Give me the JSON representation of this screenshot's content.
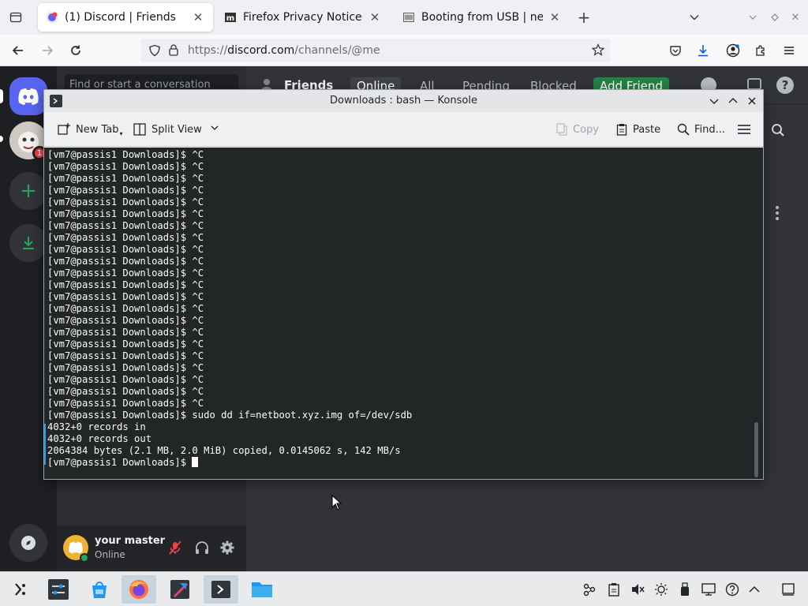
{
  "browser": {
    "tabs": [
      {
        "title": "(1) Discord | Friends",
        "active": true,
        "icon": "discord-favicon"
      },
      {
        "title": "Firefox Privacy Notice — M",
        "active": false,
        "icon": "mdn-favicon"
      },
      {
        "title": "Booting from USB | netbo",
        "active": false,
        "icon": "page-favicon"
      }
    ],
    "url_prefix": "https://",
    "url_domain": "discord.com",
    "url_path": "/channels/@me"
  },
  "discord": {
    "search_placeholder": "Find or start a conversation",
    "friends_label": "Friends",
    "friend_tabs": [
      "Online",
      "All",
      "Pending",
      "Blocked"
    ],
    "add_friend_label": "Add Friend",
    "notification_count": "1",
    "user": {
      "name": "your master",
      "status": "Online"
    },
    "accent": "#5865f2",
    "green": "#23a55a"
  },
  "konsole": {
    "title": "Downloads : bash — Konsole",
    "toolbar": {
      "new_tab": "New Tab",
      "split_view": "Split View",
      "copy": "Copy",
      "paste": "Paste",
      "find": "Find..."
    },
    "prompt": "[vm7@passis1 Downloads]$ ",
    "interrupt": "^C",
    "interrupt_count": 22,
    "command": "sudo dd if=netboot.xyz.img of=/dev/sdb",
    "output": [
      "4032+0 records in",
      "4032+0 records out",
      "2064384 bytes (2.1 MB, 2.0 MiB) copied, 0.0145062 s, 142 MB/s"
    ],
    "background": "#232627",
    "foreground": "#fcfcfc"
  },
  "taskbar": {
    "apps": [
      "app-launcher-icon",
      "settings-icon",
      "store-icon",
      "firefox-icon",
      "kate-icon",
      "konsole-icon",
      "files-icon"
    ],
    "tray": [
      "network-icon",
      "clipboard-icon",
      "volume-muted-icon",
      "brightness-icon",
      "usb-icon",
      "display-icon",
      "help-icon",
      "tray-expand-icon",
      "show-desktop-icon"
    ]
  }
}
